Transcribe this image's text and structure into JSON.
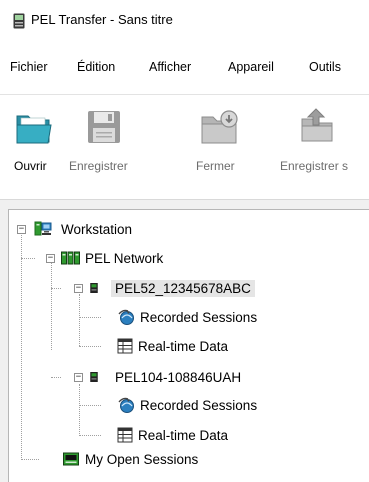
{
  "window": {
    "title": "PEL Transfer - Sans titre"
  },
  "menu": {
    "items": [
      "Fichier",
      "Édition",
      "Afficher",
      "Appareil",
      "Outils"
    ]
  },
  "toolbar": {
    "buttons": [
      {
        "label": "Ouvrir",
        "icon": "folder-open-icon",
        "enabled": true
      },
      {
        "label": "Enregistrer",
        "icon": "floppy-disk-icon",
        "enabled": false
      },
      {
        "label": "Fermer",
        "icon": "close-folder-icon",
        "enabled": false
      },
      {
        "label": "Enregistrer s",
        "icon": "save-as-icon",
        "enabled": false
      }
    ]
  },
  "tree": {
    "workstation": "Workstation",
    "network": "PEL Network",
    "device1": {
      "name": "PEL52_12345678ABC",
      "recorded": "Recorded Sessions",
      "realtime": "Real-time Data"
    },
    "device2": {
      "name": "PEL104-108846UAH",
      "recorded": "Recorded Sessions",
      "realtime": "Real-time Data"
    },
    "open_sessions": "My Open Sessions"
  },
  "colors": {
    "selection": "#e5e5e5",
    "device_green": "#2f9a2f",
    "folder_teal": "#1f8a9e"
  }
}
